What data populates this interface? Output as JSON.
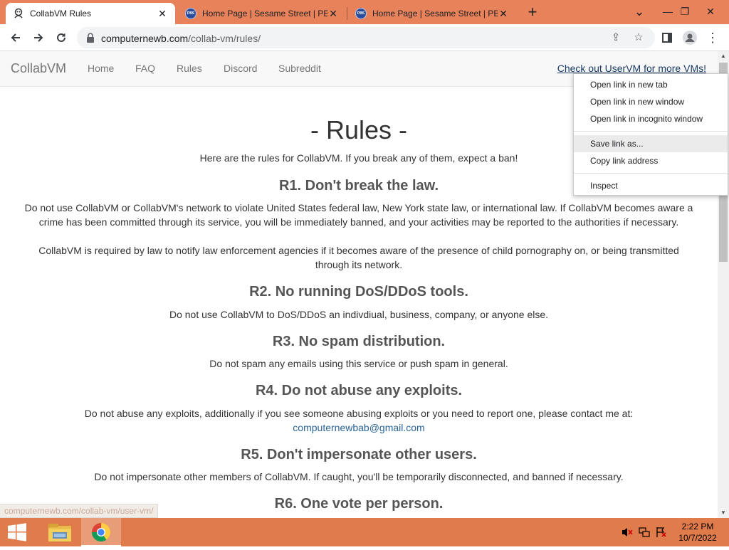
{
  "tabs": [
    {
      "title": "CollabVM Rules",
      "favicon": "collabvm-icon",
      "active": true
    },
    {
      "title": "Home Page | Sesame Street | PBS",
      "favicon": "pbs-kids-icon",
      "active": false
    },
    {
      "title": "Home Page | Sesame Street | PBS",
      "favicon": "pbs-kids-icon",
      "active": false
    }
  ],
  "window_controls": {
    "minimize": "—",
    "maximize": "❐",
    "close": "✕",
    "tab_list": "⌄"
  },
  "address_bar": {
    "host": "computernewb.com",
    "path": "/collab-vm/rules/"
  },
  "site_nav": {
    "brand": "CollabVM",
    "links": [
      "Home",
      "FAQ",
      "Rules",
      "Discord",
      "Subreddit"
    ],
    "promo": "Check out UserVM for more VMs!"
  },
  "page": {
    "title": "- Rules -",
    "intro": "Here are the rules for CollabVM. If you break any of them, expect a ban!",
    "rules": [
      {
        "heading": "R1. Don't break the law.",
        "paragraphs": [
          "Do not use CollabVM or CollabVM's network to violate United States federal law, New York state law, or international law. If CollabVM becomes aware a crime has been committed through its service, you will be immediately banned, and your activities may be reported to the authorities if necessary.",
          "CollabVM is required by law to notify law enforcement agencies if it becomes aware of the presence of child pornography on, or being transmitted through its network."
        ]
      },
      {
        "heading": "R2. No running DoS/DDoS tools.",
        "paragraphs": [
          "Do not use CollabVM to DoS/DDoS an indivdiual, business, company, or anyone else."
        ]
      },
      {
        "heading": "R3. No spam distribution.",
        "paragraphs": [
          "Do not spam any emails using this service or push spam in general."
        ]
      },
      {
        "heading": "R4. Do not abuse any exploits.",
        "paragraphs": [
          "Do not abuse any exploits, additionally if you see someone abusing exploits or you need to report one, please contact me at:"
        ],
        "email": "computernewbab@gmail.com"
      },
      {
        "heading": "R5. Don't impersonate other users.",
        "paragraphs": [
          "Do not impersonate other members of CollabVM. If caught, you'll be temporarily disconnected, and banned if necessary."
        ]
      },
      {
        "heading": "R6. One vote per person.",
        "paragraphs": []
      }
    ]
  },
  "status_url": "computernewb.com/collab-vm/user-vm/",
  "context_menu": {
    "items": [
      "Open link in new tab",
      "Open link in new window",
      "Open link in incognito window",
      "Save link as...",
      "Copy link address",
      "Inspect"
    ],
    "highlighted": "Save link as..."
  },
  "taskbar": {
    "apps": [
      "file-explorer-icon",
      "chrome-icon"
    ],
    "time": "2:22 PM",
    "date": "10/7/2022"
  },
  "colors": {
    "tab_strip": "#e8825a",
    "taskbar": "#e07c4c",
    "link": "#2a6496"
  }
}
